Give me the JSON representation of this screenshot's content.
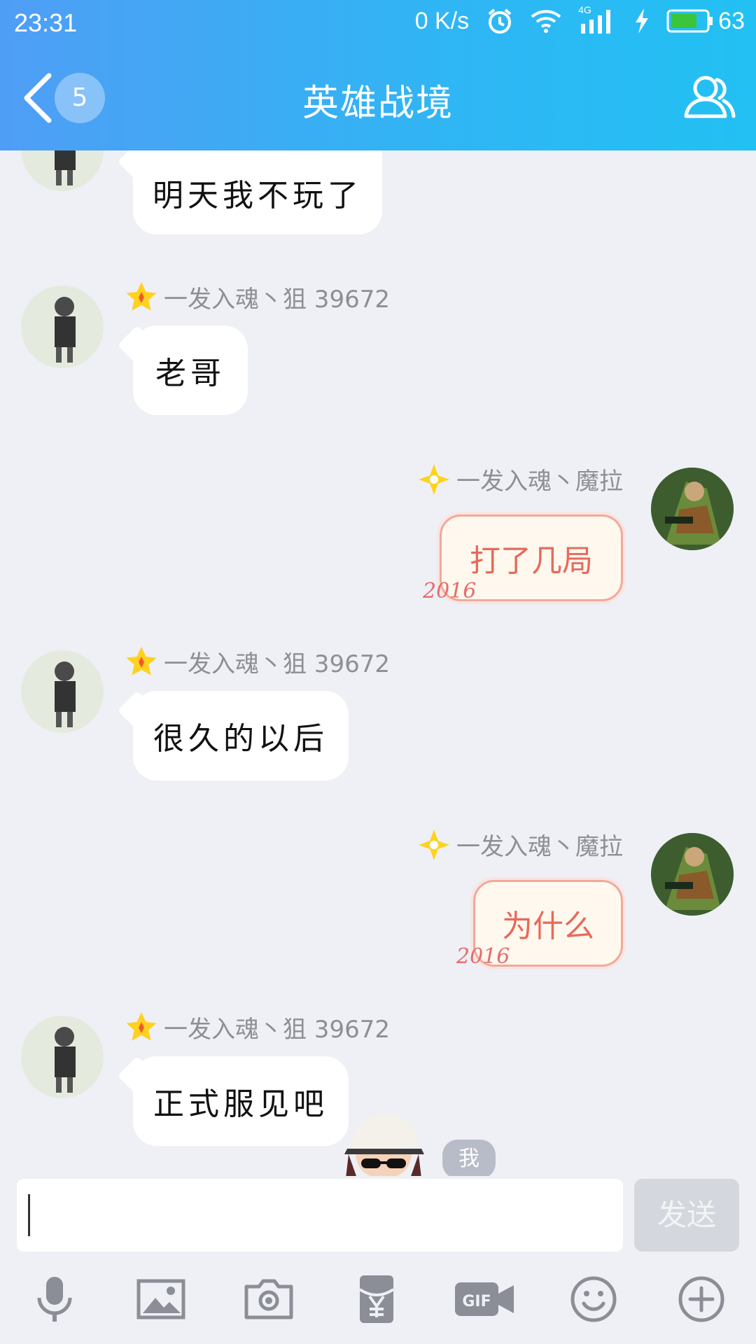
{
  "status_bar": {
    "time": "23:31",
    "net_speed": "0 K/s",
    "battery": "63",
    "network_type": "4G"
  },
  "header": {
    "title": "英雄战境",
    "unread_count": "5"
  },
  "messages": [
    {
      "side": "left",
      "sender": "",
      "text": "明天我不玩了"
    },
    {
      "side": "left",
      "sender": "一发入魂丶狙 39672",
      "text": "老哥"
    },
    {
      "side": "right",
      "sender": "一发入魂丶魔拉",
      "text": "打了几局"
    },
    {
      "side": "left",
      "sender": "一发入魂丶狙 39672",
      "text": "很久的以后"
    },
    {
      "side": "right",
      "sender": "一发入魂丶魔拉",
      "text": "为什么"
    },
    {
      "side": "left",
      "sender": "一发入魂丶狙 39672",
      "text": "正式服见吧"
    }
  ],
  "bubble_decoration": "2016",
  "me_label": "我",
  "input": {
    "value": "",
    "send_label": "发送"
  },
  "toolbar": {
    "icons": [
      "microphone-icon",
      "image-icon",
      "camera-icon",
      "red-packet-icon",
      "gif-icon",
      "emoji-icon",
      "plus-icon"
    ]
  },
  "colors": {
    "header_start": "#4f9ef5",
    "header_end": "#22c0f3",
    "chat_bg": "#eef0f5",
    "right_bubble_text": "#e76a5a",
    "badge_gold": "#ffd21f"
  }
}
